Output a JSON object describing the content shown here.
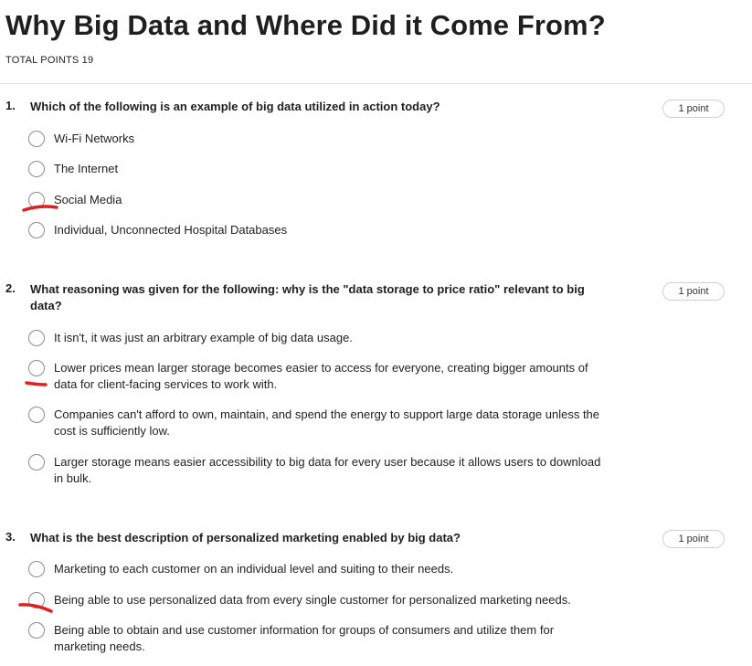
{
  "quiz": {
    "title": "Why Big Data and Where Did it Come From?",
    "total_points": "TOTAL POINTS 19"
  },
  "questions": [
    {
      "number": "1.",
      "text": "Which of the following is an example of big data utilized in action today?",
      "points": "1 point",
      "options": [
        "Wi-Fi Networks",
        "The Internet",
        "Social Media",
        "Individual, Unconnected Hospital Databases"
      ]
    },
    {
      "number": "2.",
      "text": "What reasoning was given for the following: why is the \"data storage to price ratio\" relevant to big data?",
      "points": "1 point",
      "options": [
        "It isn't, it was just an arbitrary example of big data usage.",
        "Lower prices mean larger storage becomes easier to access for everyone, creating bigger amounts of data for client-facing services to work with.",
        "Companies can't afford to own, maintain, and spend the energy to support large data storage unless the cost is sufficiently low.",
        "Larger storage means easier accessibility to big data for every user because it allows users to download in bulk."
      ]
    },
    {
      "number": "3.",
      "text": "What is the best description of personalized marketing enabled by big data?",
      "points": "1 point",
      "options": [
        "Marketing to each customer on an individual level and suiting to their needs.",
        "Being able to use personalized data from every single customer for personalized marketing needs.",
        "Being able to obtain and use customer information for groups of consumers and utilize them for marketing needs."
      ]
    }
  ],
  "annotation_color": "#e02020"
}
